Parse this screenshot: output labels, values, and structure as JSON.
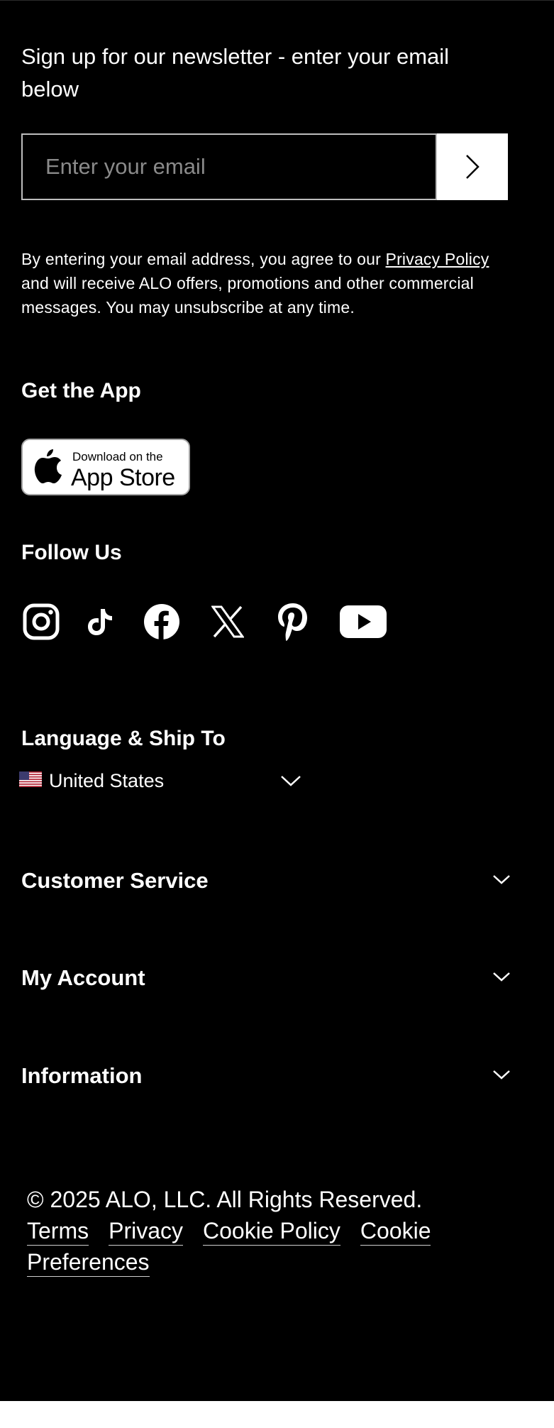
{
  "newsletter": {
    "prompt": "Sign up for our newsletter - enter your email below",
    "email_placeholder": "Enter your email",
    "email_value": "",
    "legal_before": "By entering your email address, you agree to our ",
    "legal_link": "Privacy Policy",
    "legal_after": " and will receive ALO offers, promotions and other commercial messages. You may unsubscribe at any time."
  },
  "app": {
    "heading": "Get the App",
    "badge_small": "Download on the",
    "badge_big": "App Store"
  },
  "follow": {
    "heading": "Follow Us",
    "icons": [
      "instagram-icon",
      "tiktok-icon",
      "facebook-icon",
      "x-icon",
      "pinterest-icon",
      "youtube-icon"
    ]
  },
  "locale": {
    "heading": "Language & Ship To",
    "country": "United States",
    "flag_icon": "us-flag-icon"
  },
  "accordion": {
    "customer_service": "Customer Service",
    "my_account": "My Account",
    "information": "Information"
  },
  "legal_footer": {
    "copyright": "© 2025 ALO, LLC. All Rights Reserved.",
    "links": [
      "Terms",
      "Privacy",
      "Cookie Policy",
      "Cookie Preferences"
    ]
  },
  "colors": {
    "background": "#000000",
    "text": "#ffffff",
    "input_border": "#bdbdbd",
    "placeholder": "#8a8a8a"
  }
}
